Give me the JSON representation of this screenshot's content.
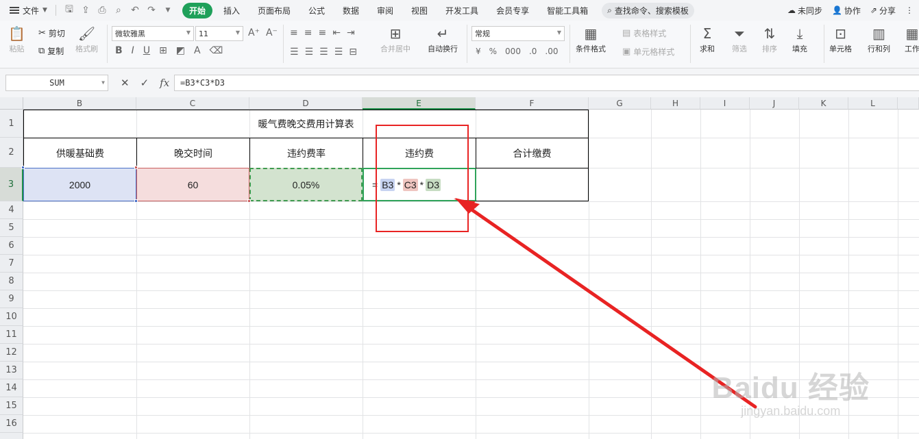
{
  "menubar": {
    "file_label": "文件",
    "tabs": [
      "开始",
      "插入",
      "页面布局",
      "公式",
      "数据",
      "审阅",
      "视图",
      "开发工具",
      "会员专享",
      "智能工具箱"
    ],
    "active_tab": "开始",
    "search_label": "查找命令、搜索模板",
    "sync_label": "未同步",
    "collab_label": "协作",
    "share_label": "分享"
  },
  "ribbon": {
    "paste": "粘贴",
    "cut": "剪切",
    "copy": "复制",
    "format_painter": "格式刷",
    "font_name": "微软雅黑",
    "font_size": "11",
    "merge_center": "合并居中",
    "wrap_text": "自动换行",
    "number_format": "常规",
    "cond_format": "条件格式",
    "table_style": "表格样式",
    "cell_style": "单元格样式",
    "sum": "求和",
    "filter": "筛选",
    "sort": "排序",
    "fill": "填充",
    "cells": "单元格",
    "rows_cols": "行和列",
    "worksheet": "工作"
  },
  "formula_bar": {
    "name_box": "SUM",
    "formula": "=B3*C3*D3"
  },
  "grid": {
    "columns": [
      "B",
      "C",
      "D",
      "E",
      "F",
      "G",
      "H",
      "I",
      "J",
      "K",
      "L"
    ],
    "rows": [
      "1",
      "2",
      "3",
      "4",
      "5",
      "6",
      "7",
      "8",
      "9",
      "10",
      "11",
      "12",
      "13",
      "14",
      "15",
      "16"
    ],
    "title": "暖气费晚交费用计算表",
    "headers": [
      "供暖基础费",
      "晚交时间",
      "违约费率",
      "违约费",
      "合计缴费"
    ],
    "values": {
      "b3": "2000",
      "c3": "60",
      "d3": "0.05%"
    },
    "edit_formula": {
      "eq": "=",
      "b": "B3",
      "c": "C3",
      "d": "D3",
      "op": "*"
    }
  },
  "watermark": {
    "brand": "Baidu 经验",
    "url": "jingyan.baidu.com"
  },
  "colors": {
    "accent_green": "#1fa05a",
    "annotation_red": "#e82323"
  }
}
